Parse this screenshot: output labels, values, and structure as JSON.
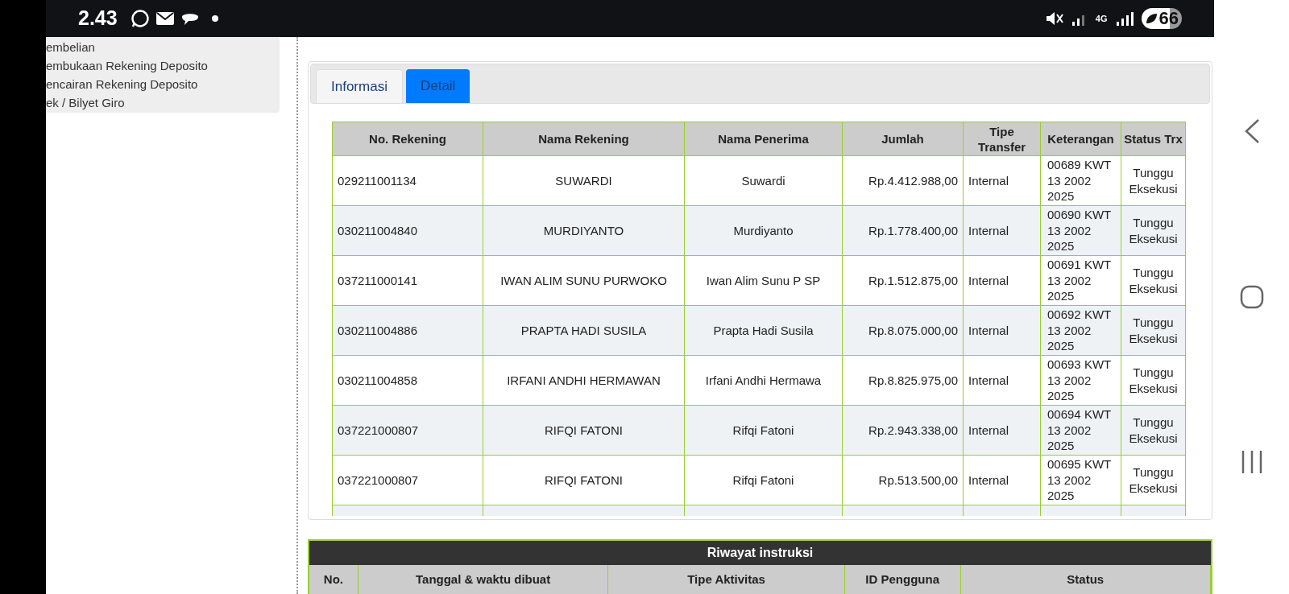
{
  "status_bar": {
    "time": "2.43",
    "network": "4G",
    "battery": "66"
  },
  "sidebar": {
    "items": [
      "embelian",
      "embukaan Rekening Deposito",
      "encairan Rekening Deposito",
      "ek / Bilyet Giro"
    ]
  },
  "tabs": [
    {
      "label": "Informasi",
      "selected": false
    },
    {
      "label": "Detail",
      "selected": true
    }
  ],
  "detail_table": {
    "columns": [
      "No. Rekening",
      "Nama Rekening",
      "Nama Penerima",
      "Jumlah",
      "Tipe Transfer",
      "Keterangan",
      "Status Trx"
    ],
    "rows": [
      [
        "029211001134",
        "SUWARDI",
        "Suwardi",
        "Rp.4.412.988,00",
        "Internal",
        "00689 KWT 13 2002 2025",
        "Tunggu Eksekusi"
      ],
      [
        "030211004840",
        "MURDIYANTO",
        "Murdiyanto",
        "Rp.1.778.400,00",
        "Internal",
        "00690 KWT 13 2002 2025",
        "Tunggu Eksekusi"
      ],
      [
        "037211000141",
        "IWAN ALIM SUNU PURWOKO",
        "Iwan Alim Sunu P SP",
        "Rp.1.512.875,00",
        "Internal",
        "00691 KWT 13 2002 2025",
        "Tunggu Eksekusi"
      ],
      [
        "030211004886",
        "PRAPTA HADI SUSILA",
        "Prapta Hadi Susila",
        "Rp.8.075.000,00",
        "Internal",
        "00692 KWT 13 2002 2025",
        "Tunggu Eksekusi"
      ],
      [
        "030211004858",
        "IRFANI ANDHI HERMAWAN",
        "Irfani Andhi Hermawa",
        "Rp.8.825.975,00",
        "Internal",
        "00693 KWT 13 2002 2025",
        "Tunggu Eksekusi"
      ],
      [
        "037221000807",
        "RIFQI FATONI",
        "Rifqi Fatoni",
        "Rp.2.943.338,00",
        "Internal",
        "00694 KWT 13 2002 2025",
        "Tunggu Eksekusi"
      ],
      [
        "037221000807",
        "RIFQI FATONI",
        "Rifqi Fatoni",
        "Rp.513.500,00",
        "Internal",
        "00695 KWT 13 2002 2025",
        "Tunggu Eksekusi"
      ]
    ]
  },
  "history": {
    "title": "Riwayat instruksi",
    "columns": [
      "No.",
      "Tanggal & waktu dibuat",
      "Tipe Aktivitas",
      "ID Pengguna",
      "Status"
    ]
  }
}
